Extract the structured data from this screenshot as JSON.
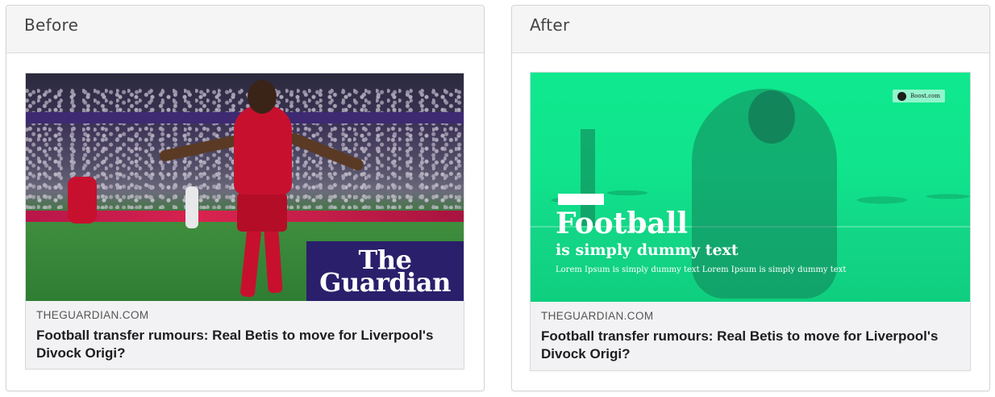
{
  "before": {
    "panel_title": "Before",
    "image_logo_line1": "The",
    "image_logo_line2": "Guardian",
    "source": "THEGUARDIAN.COM",
    "headline": "Football transfer rumours: Real Betis to move for Liverpool's Divock Origi?"
  },
  "after": {
    "panel_title": "After",
    "overlay_title": "Football",
    "overlay_subtitle": "is simply dummy text",
    "overlay_body": "Lorem Ipsum is simply dummy text Lorem Ipsum is simply dummy text",
    "brand_text": "Boost.com",
    "source": "THEGUARDIAN.COM",
    "headline": "Football transfer rumours: Real Betis to move for Liverpool's Divock Origi?"
  },
  "colors": {
    "guardian_blue": "#2a1f6b",
    "overlay_green": "#10e38c",
    "headline_text": "#1d1d1f"
  }
}
